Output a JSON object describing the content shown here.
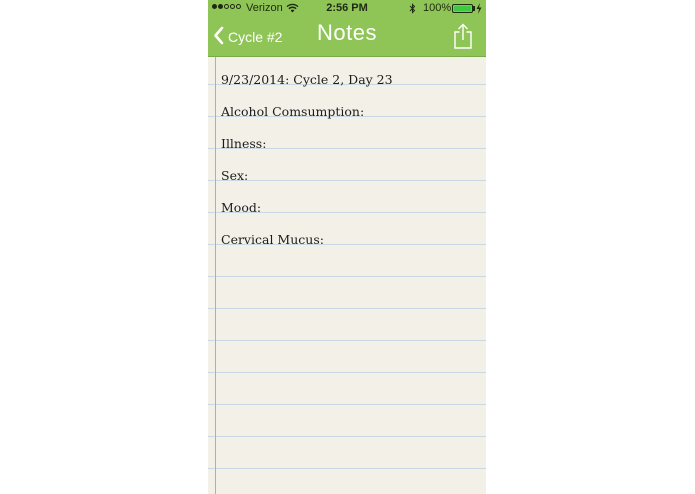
{
  "status_bar": {
    "carrier": "Verizon",
    "time": "2:56 PM",
    "battery_percent": "100%",
    "battery_level": 1.0,
    "signal_bars_filled": 2,
    "signal_bars_total": 5,
    "battery_color": "#3ec93e"
  },
  "nav": {
    "back_label": "Cycle #2",
    "title": "Notes",
    "share_icon": "share-icon",
    "bar_color": "#8fc556"
  },
  "notes": {
    "lines": [
      "9/23/2014: Cycle 2, Day 23",
      "Alcohol Comsumption:",
      "Illness:",
      "Sex:",
      "Mood:",
      "Cervical Mucus:"
    ],
    "paper_color": "#f3f0e8",
    "rule_color": "#c9d8e4",
    "margin_color": "#e89b84"
  }
}
